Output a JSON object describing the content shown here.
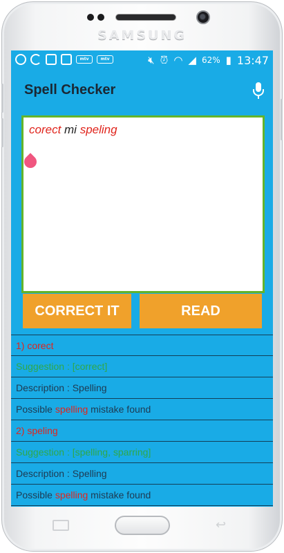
{
  "device": {
    "brand": "SAMSUNG"
  },
  "statusbar": {
    "battery": "62%",
    "time": "13:47",
    "left_icons": [
      "add-icon",
      "moon-icon",
      "image-icon",
      "gmail-icon",
      "mtv-icon",
      "mtv-icon"
    ],
    "right_icons": [
      "mute-icon",
      "alarm-icon",
      "wifi-icon",
      "signal-icon",
      "battery-icon"
    ],
    "mtv_label": "mtv"
  },
  "appbar": {
    "title": "Spell Checker",
    "mic_icon": "mic-icon"
  },
  "editor": {
    "segments": [
      {
        "text": "corect",
        "misspelt": true
      },
      {
        "text": " mi ",
        "misspelt": false
      },
      {
        "text": "speling",
        "misspelt": true
      }
    ]
  },
  "buttons": {
    "correct_label": "CORRECT IT",
    "read_label": "READ"
  },
  "results": [
    {
      "type": "word",
      "text": "1) corect"
    },
    {
      "type": "sugg",
      "text": "Suggestion : [correct]"
    },
    {
      "type": "desc",
      "text": "Description : Spelling"
    },
    {
      "type": "msg",
      "pre": "Possible ",
      "hl": "spelling",
      "post": " mistake found"
    },
    {
      "type": "word",
      "text": "2) speling"
    },
    {
      "type": "sugg",
      "text": "Suggestion : [spelling, sparring]"
    },
    {
      "type": "desc",
      "text": "Description : Spelling"
    },
    {
      "type": "msg",
      "pre": "Possible ",
      "hl": "spelling",
      "post": " mistake found"
    }
  ],
  "colors": {
    "screen_bg": "#19abe6",
    "editor_border": "#63b42a",
    "button_bg": "#f0a12b",
    "error_red": "#e0251d",
    "suggestion_green": "#2fa84a"
  }
}
